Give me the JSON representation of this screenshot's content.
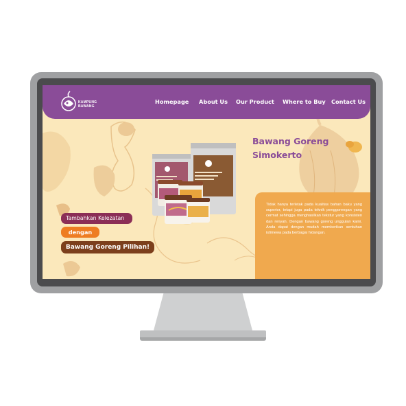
{
  "brand": {
    "name_line1": "KAMPUNG",
    "name_line2": "BAWANG"
  },
  "nav": {
    "homepage": "Homepage",
    "about": "About Us",
    "product": "Our Product",
    "where": "Where to Buy",
    "contact": "Contact Us"
  },
  "hero": {
    "title_line1": "Bawang Goreng",
    "title_line2": "Simokerto",
    "description": "Tidak hanya terletak pada kualitas bahan baku yang superior, tetapi juga pada teknik penggorengan yang cermat sehingga menghasilkan tekstur yang konsisten dan renyah. Dengan bawang goreng unggulan kami. Anda dapat dengan mudah memberikan sentuhan istimewa pada berbagai hidangan.",
    "tagline1": "Tambahkan Kelezatan",
    "tagline2": "dengan",
    "tagline3": "Bawang Goreng Pilihan!"
  },
  "colors": {
    "navbar": "#8a4c98",
    "background": "#fbe8bb",
    "description_box": "#f0a94e",
    "tag1": "#8b2e56",
    "tag2": "#ee7d22",
    "tag3": "#7c3f1c",
    "monitor_frame": "#9fa0a2",
    "bezel": "#4b4b4d"
  }
}
